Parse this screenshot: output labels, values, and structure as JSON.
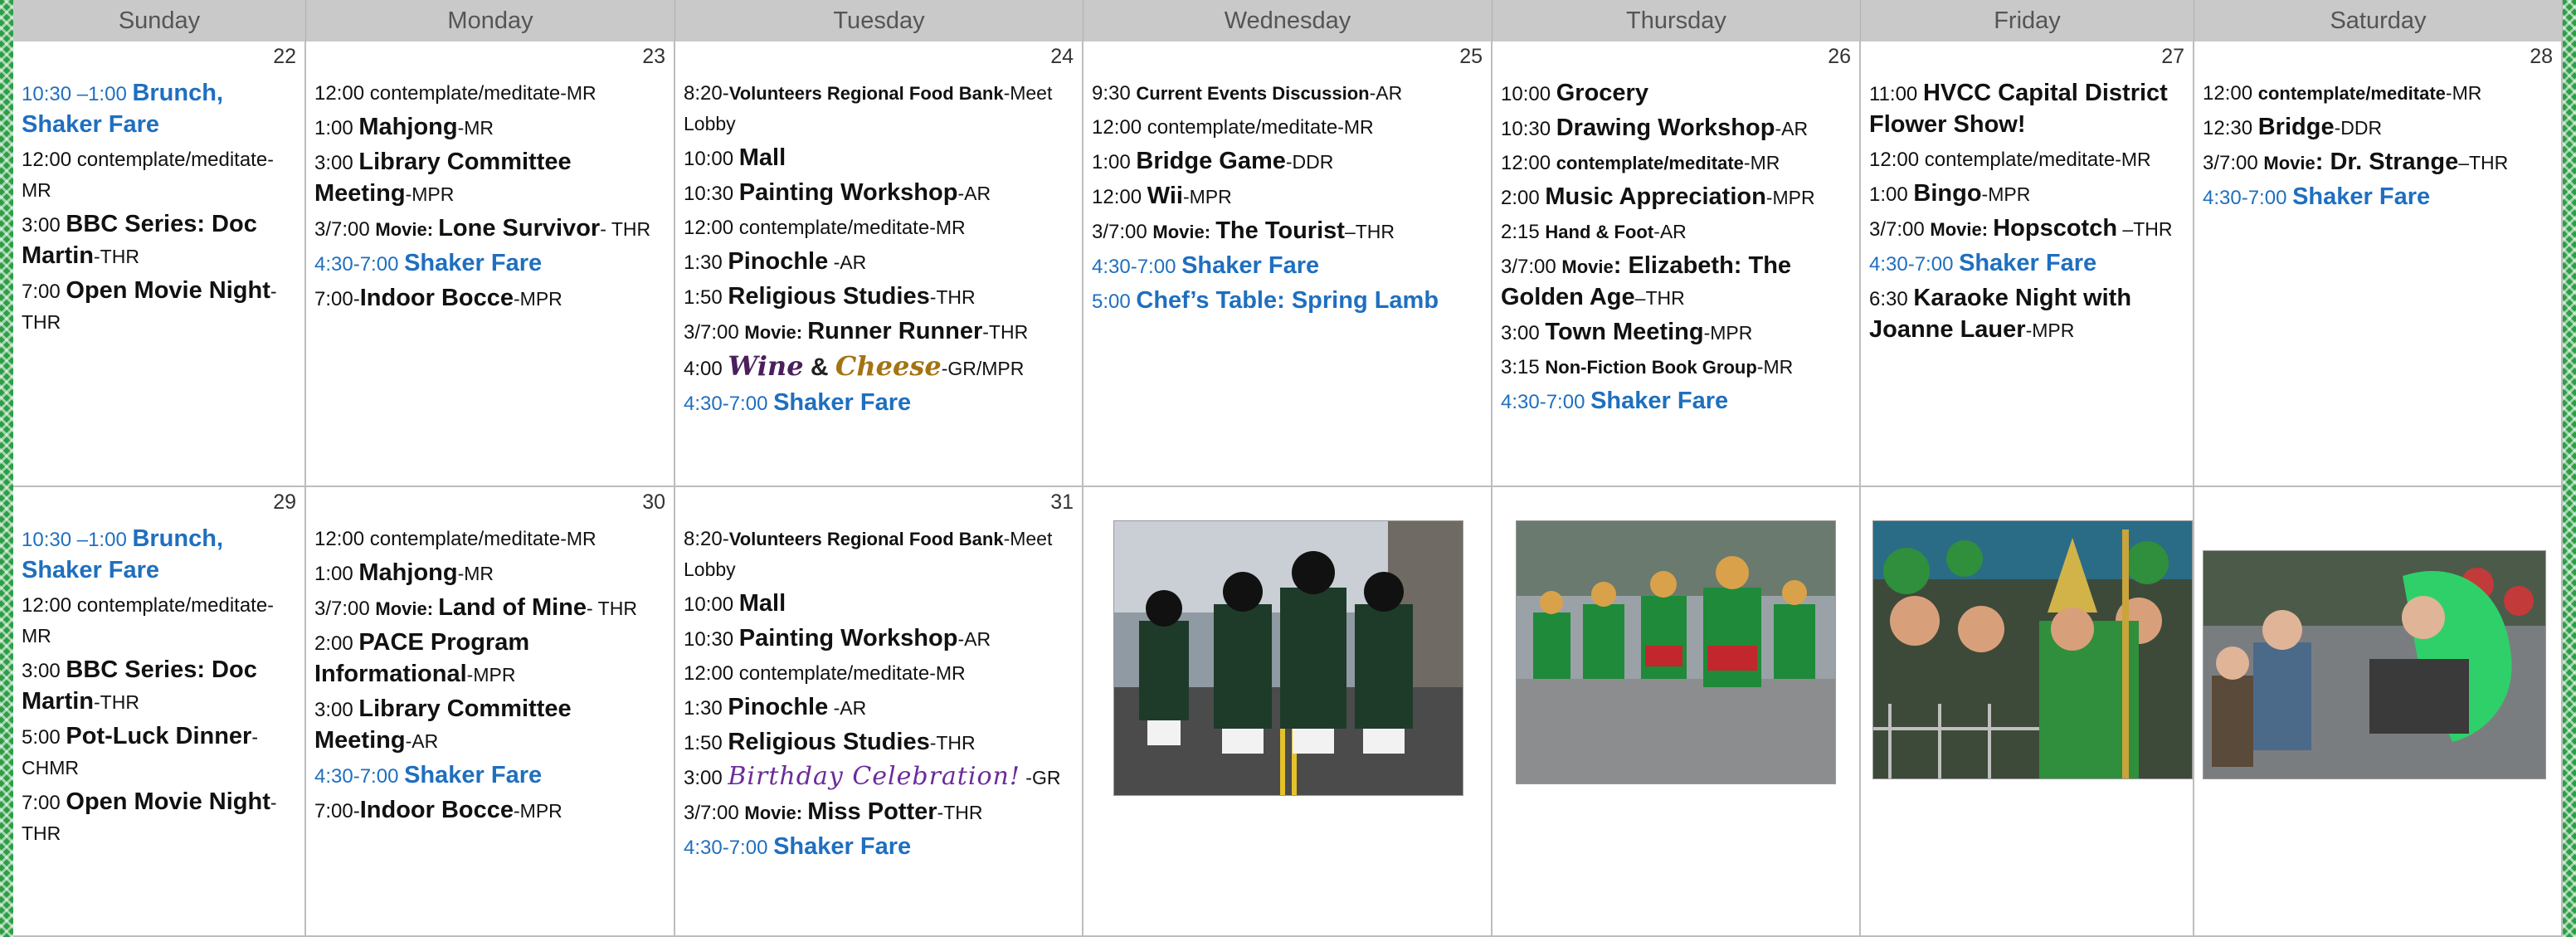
{
  "days": [
    "Sunday",
    "Monday",
    "Tuesday",
    "Wednesday",
    "Thursday",
    "Friday",
    "Saturday"
  ],
  "dates": [
    "22",
    "23",
    "24",
    "25",
    "26",
    "27",
    "28",
    "29",
    "30",
    "31"
  ],
  "colors": {
    "accent_blue": "#1f6fbf",
    "border_green": "#2e9e46",
    "header_gray": "#c9c9c9",
    "wine_purple": "#4b1f5c",
    "cheese_gold": "#a47412",
    "birthday_purple": "#6a2c9a"
  },
  "week1": {
    "sun": [
      {
        "time": "10:30 –1:00 ",
        "title": "Brunch, Shaker Fare",
        "loc": ""
      },
      {
        "time": "12:00 contemplate/meditate",
        "title": "",
        "loc": "-MR"
      },
      {
        "time": "3:00 ",
        "title": "BBC Series: Doc Martin",
        "loc": "-THR"
      },
      {
        "time": "7:00 ",
        "title": "Open Movie Night",
        "loc": "-THR"
      }
    ],
    "mon": [
      {
        "time": "12:00 contemplate/meditate",
        "title": "",
        "loc": "-MR"
      },
      {
        "time": "1:00 ",
        "title": "Mahjong",
        "loc": "-MR"
      },
      {
        "time": "3:00 ",
        "title": "Library Committee Meeting",
        "loc": "-MPR"
      },
      {
        "time": "3/7:00 ",
        "sub": "Movie: ",
        "title": "Lone Survivor",
        "loc": "- THR"
      },
      {
        "time": "4:30-7:00 ",
        "title": "Shaker Fare",
        "loc": ""
      },
      {
        "time": "7:00-",
        "title": "Indoor Bocce",
        "loc": "-MPR"
      }
    ],
    "tue": [
      {
        "time": "8:20-",
        "sub": "Volunteers Regional Food Bank",
        "title": "",
        "loc": "-Meet Lobby"
      },
      {
        "time": "10:00 ",
        "title": "Mall",
        "loc": ""
      },
      {
        "time": "10:30 ",
        "title": "Painting Workshop",
        "loc": "-AR"
      },
      {
        "time": "12:00 contemplate/meditate",
        "title": "",
        "loc": "-MR"
      },
      {
        "time": "1:30 ",
        "title": "Pinochle",
        "loc": " -AR"
      },
      {
        "time": "1:50 ",
        "title": "Religious Studies",
        "loc": "-THR"
      },
      {
        "time": "3/7:00 ",
        "sub": "Movie: ",
        "title": "Runner Runner",
        "loc": "-THR"
      },
      {
        "time": "4:00 ",
        "wine": "Wine",
        "amp": " & ",
        "cheese": "Cheese",
        "loc": "-GR/MPR"
      },
      {
        "time": "4:30-7:00 ",
        "title": "Shaker Fare",
        "loc": ""
      }
    ],
    "wed": [
      {
        "time": "9:30 ",
        "sub": "Current Events Discussion",
        "title": "",
        "loc": "-AR"
      },
      {
        "time": "12:00 contemplate/meditate",
        "title": "",
        "loc": "-MR"
      },
      {
        "time": "1:00 ",
        "title": "Bridge Game",
        "loc": "-DDR"
      },
      {
        "time": "12:00 ",
        "title": "Wii",
        "loc": "-MPR"
      },
      {
        "time": "3/7:00 ",
        "sub": "Movie: ",
        "title": "The Tourist",
        "loc": "–THR"
      },
      {
        "time": "4:30-7:00 ",
        "title": "Shaker Fare",
        "loc": ""
      },
      {
        "time": "5:00 ",
        "title": "Chef’s Table: Spring Lamb",
        "loc": ""
      }
    ],
    "thu": [
      {
        "time": "10:00 ",
        "title": "Grocery",
        "loc": ""
      },
      {
        "time": "10:30 ",
        "title": "Drawing Workshop",
        "loc": "-AR"
      },
      {
        "time": "12:00 ",
        "sub": "contemplate/meditate",
        "title": "",
        "loc": "-MR"
      },
      {
        "time": "2:00 ",
        "title": "Music Appreciation",
        "loc": "-MPR"
      },
      {
        "time": "2:15 ",
        "sub": "Hand & Foot",
        "title": "",
        "loc": "-AR"
      },
      {
        "time": "3/7:00 ",
        "sub": "Movie",
        "title": ": Elizabeth: The Golden Age",
        "loc": "–THR"
      },
      {
        "time": "3:00 ",
        "title": "Town Meeting",
        "loc": "-MPR"
      },
      {
        "time": "3:15 ",
        "sub": "Non-Fiction Book Group",
        "title": "",
        "loc": "-MR"
      },
      {
        "time": "4:30-7:00 ",
        "title": "Shaker Fare",
        "loc": ""
      }
    ],
    "fri": [
      {
        "time": "11:00 ",
        "title": "HVCC Capital District Flower Show!",
        "loc": ""
      },
      {
        "time": "12:00 contemplate/meditate",
        "title": "",
        "loc": "-MR"
      },
      {
        "time": "1:00 ",
        "title": "Bingo",
        "loc": "-MPR"
      },
      {
        "time": "3/7:00 ",
        "sub": "Movie: ",
        "title": "Hopscotch",
        "loc": " –THR"
      },
      {
        "time": "4:30-7:00 ",
        "title": "Shaker Fare",
        "loc": ""
      },
      {
        "time": "6:30 ",
        "title": "Karaoke Night with Joanne Lauer",
        "loc": "-MPR"
      }
    ],
    "sat": [
      {
        "time": "12:00 ",
        "sub": "contemplate/meditate",
        "title": "",
        "loc": "-MR"
      },
      {
        "time": "12:30 ",
        "title": "Bridge",
        "loc": "-DDR"
      },
      {
        "time": "3/7:00 ",
        "sub": "Movie",
        "title": ": Dr. Strange",
        "loc": "–THR"
      },
      {
        "time": "4:30-7:00 ",
        "title": "Shaker Fare",
        "loc": ""
      }
    ]
  },
  "week2": {
    "sun": [
      {
        "time": "10:30 –1:00 ",
        "title": "Brunch, Shaker Fare",
        "loc": ""
      },
      {
        "time": "12:00 contemplate/meditate",
        "title": "",
        "loc": "-MR"
      },
      {
        "time": "3:00 ",
        "title": "BBC Series: Doc Martin",
        "loc": "-THR"
      },
      {
        "time": "5:00 ",
        "title": "Pot-Luck Dinner",
        "loc": "-CHMR"
      },
      {
        "time": "7:00 ",
        "title": "Open Movie Night",
        "loc": "-THR"
      }
    ],
    "mon": [
      {
        "time": "12:00 contemplate/meditate",
        "title": "",
        "loc": "-MR"
      },
      {
        "time": "1:00 ",
        "title": "Mahjong",
        "loc": "-MR"
      },
      {
        "time": "3/7:00 ",
        "sub": "Movie: ",
        "title": "Land of Mine",
        "loc": "- THR"
      },
      {
        "time": "2:00 ",
        "title": "PACE Program Informational",
        "loc": "-MPR"
      },
      {
        "time": "3:00 ",
        "title": "Library Committee Meeting",
        "loc": "-AR"
      },
      {
        "time": "4:30-7:00 ",
        "title": "Shaker Fare",
        "loc": ""
      },
      {
        "time": "7:00-",
        "title": "Indoor Bocce",
        "loc": "-MPR"
      }
    ],
    "tue": [
      {
        "time": "8:20-",
        "sub": "Volunteers Regional Food Bank",
        "title": "",
        "loc": "-Meet Lobby"
      },
      {
        "time": "10:00 ",
        "title": "Mall",
        "loc": ""
      },
      {
        "time": "10:30 ",
        "title": "Painting Workshop",
        "loc": "-AR"
      },
      {
        "time": "12:00 contemplate/meditate",
        "title": "",
        "loc": "-MR"
      },
      {
        "time": "1:30 ",
        "title": "Pinochle",
        "loc": " -AR"
      },
      {
        "time": "1:50 ",
        "title": "Religious Studies",
        "loc": "-THR"
      },
      {
        "time": "3:00 ",
        "bday": "Birthday Celebration!",
        "loc": " -GR"
      },
      {
        "time": "3/7:00 ",
        "sub": "Movie: ",
        "title": "Miss Potter",
        "loc": "-THR"
      },
      {
        "time": "4:30-7:00 ",
        "title": "Shaker Fare",
        "loc": ""
      }
    ]
  }
}
